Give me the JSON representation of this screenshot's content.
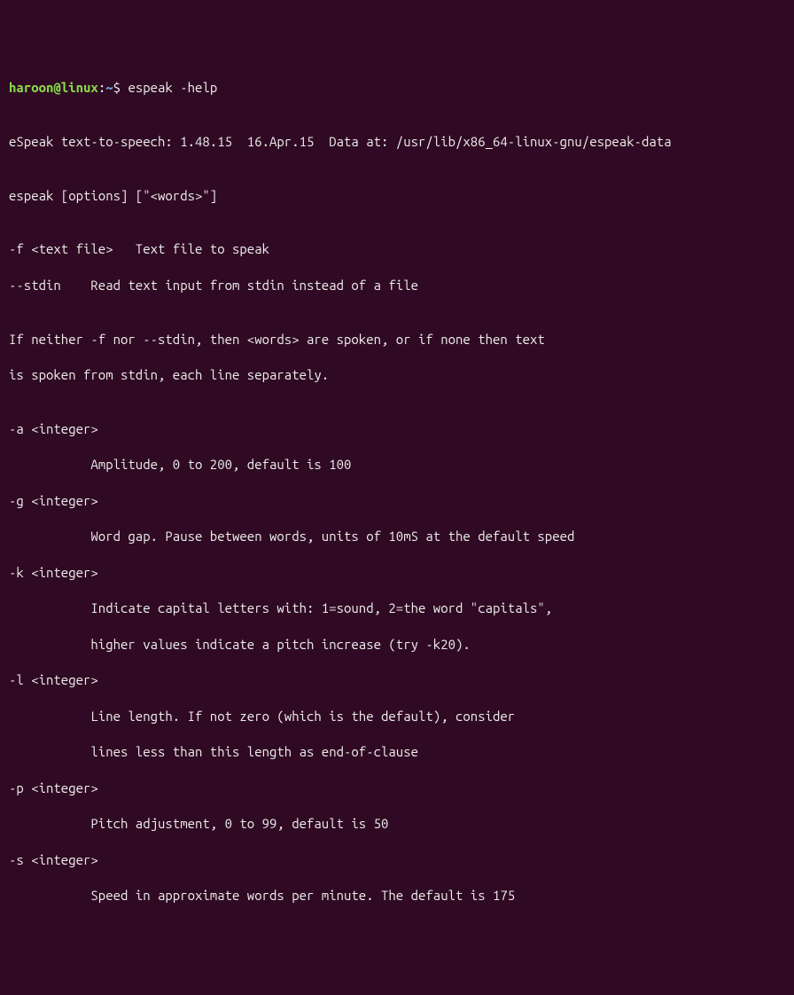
{
  "prompt": {
    "user_host": "haroon@linux",
    "colon": ":",
    "path": "~",
    "dollar": "$ "
  },
  "command": "espeak -help",
  "output": {
    "l01": "",
    "l02": "eSpeak text-to-speech: 1.48.15  16.Apr.15  Data at: /usr/lib/x86_64-linux-gnu/espeak-data",
    "l03": "",
    "l04": "espeak [options] [\"<words>\"]",
    "l05": "",
    "l06": "-f <text file>   Text file to speak",
    "l07": "--stdin    Read text input from stdin instead of a file",
    "l08": "",
    "l09": "If neither -f nor --stdin, then <words> are spoken, or if none then text",
    "l10": "is spoken from stdin, each line separately.",
    "l11": "",
    "l12": "-a <integer>",
    "l13": "           Amplitude, 0 to 200, default is 100",
    "l14": "-g <integer>",
    "l15": "           Word gap. Pause between words, units of 10mS at the default speed",
    "l16": "-k <integer>",
    "l17": "           Indicate capital letters with: 1=sound, 2=the word \"capitals\",",
    "l18": "           higher values indicate a pitch increase (try -k20).",
    "l19": "-l <integer>",
    "l20": "           Line length. If not zero (which is the default), consider",
    "l21": "           lines less than this length as end-of-clause",
    "l22": "-p <integer>",
    "l23": "           Pitch adjustment, 0 to 99, default is 50",
    "l24": "-s <integer>",
    "l25": "           Speed in approximate words per minute. The default is 175"
  }
}
